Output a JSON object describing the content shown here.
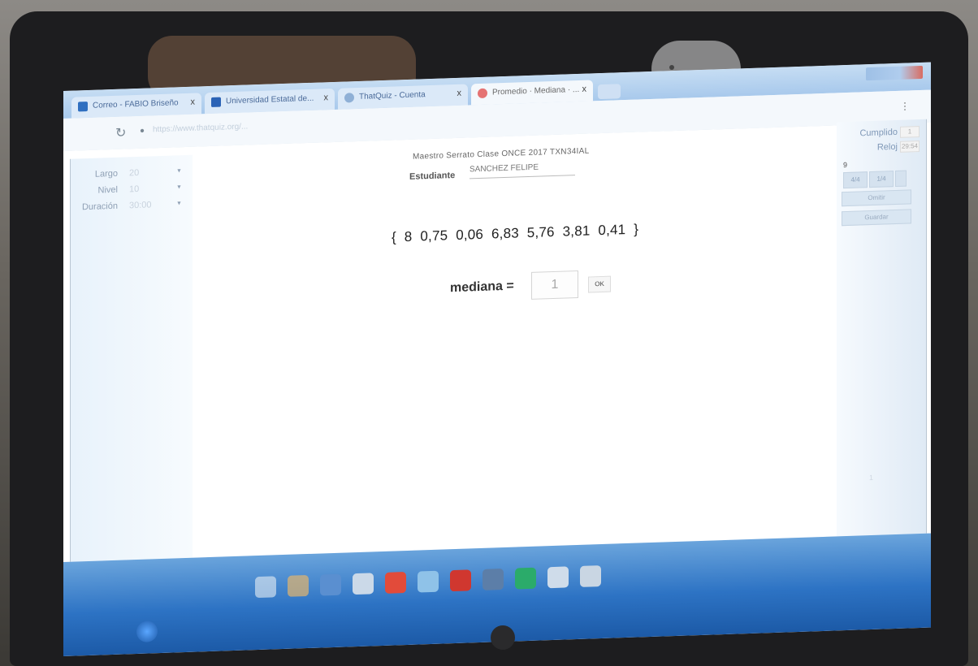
{
  "browser": {
    "tabs": [
      {
        "label": "Correo - FABIO Briseño",
        "icon_color": "#2f6fc0",
        "active": false
      },
      {
        "label": "Universidad Estatal de...",
        "icon_color": "#2b63b6",
        "active": false
      },
      {
        "label": "ThatQuiz - Cuenta",
        "icon_color": "#8fb0d6",
        "active": false
      },
      {
        "label": "Promedio · Mediana · ...",
        "icon_color": "#e57373",
        "active": true
      }
    ],
    "close_glyph": "x",
    "url": "https://www.thatquiz.org/..."
  },
  "settings": {
    "largo": {
      "label": "Largo",
      "value": "20"
    },
    "nivel": {
      "label": "Nivel",
      "value": "10"
    },
    "duracion": {
      "label": "Duración",
      "value": "30:00"
    }
  },
  "header": {
    "teacher_line": "Maestro Serrato   Clase ONCE 2017   TXN34IAL",
    "student_label": "Estudiante",
    "student_name": "SANCHEZ FELIPE"
  },
  "question": {
    "dataset": "{ 8   0,75   0,06   6,83   5,76   3,81   0,41 }",
    "prompt": "mediana =",
    "answer": "1",
    "ok_label": "OK"
  },
  "sidebar": {
    "cumplido_label": "Cumplido",
    "cumplido_value": "1",
    "reloj_label": "Reloj",
    "reloj_value": "29:54",
    "counter": "9",
    "nav_prev": "4/4",
    "nav_next": "1/4",
    "omitir_label": "Omitir",
    "guardar_label": "Guardar",
    "ring_value": "1"
  },
  "icons": {
    "reload": "reload-icon",
    "star": "star-icon",
    "menu": "menu-icon",
    "start": "windows-start-icon"
  }
}
